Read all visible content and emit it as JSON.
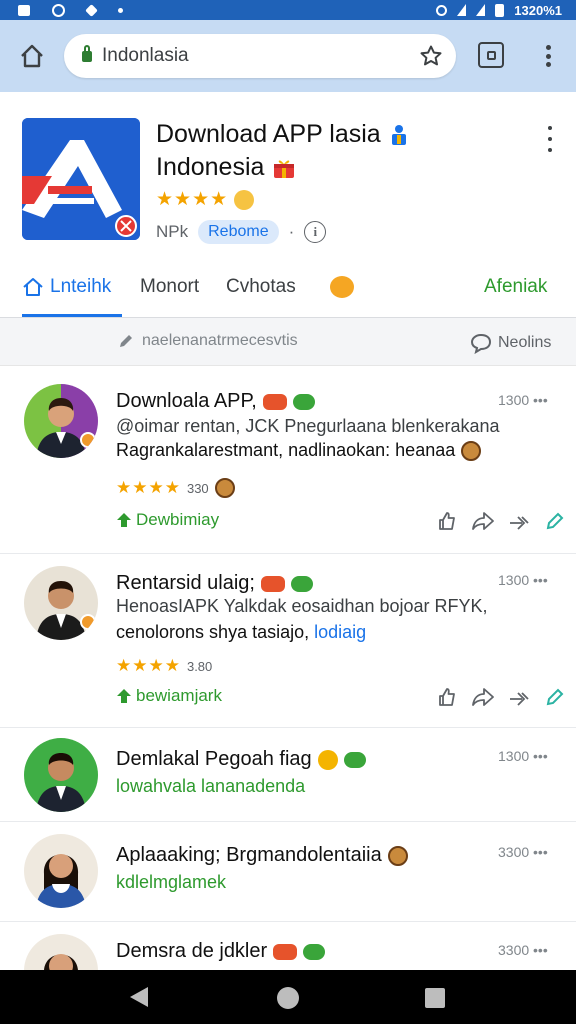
{
  "status_bar": {
    "time": "1320%1"
  },
  "browser": {
    "url": "Indonlasia",
    "home_icon": "home-icon",
    "star_icon": "star-outline-icon",
    "tabs_icon": "tabs-icon",
    "menu_icon": "more-vert-icon"
  },
  "app": {
    "title_line1": "Download APP lasia",
    "title_line2": "Indonesia",
    "stars": "★★★★",
    "meta_prefix": "NPk",
    "chip": "Rebome",
    "info": "i",
    "logo_letter": "A",
    "colors": {
      "brand_blue": "#1f5fcf",
      "accent_red": "#e53935",
      "link_blue": "#1a73e8",
      "green": "#2e9a2e"
    }
  },
  "tabs": [
    {
      "label": "Lnteihk",
      "active": true
    },
    {
      "label": "Monort"
    },
    {
      "label": "Cvhotas"
    },
    {
      "label": ""
    },
    {
      "label": "Afeniak"
    }
  ],
  "filter": {
    "left": "naelenanatrmecesvtis",
    "right": "Neolins"
  },
  "posts": [
    {
      "title": "Downloala APP,",
      "time": "1300 •••",
      "line1": "@oimar rentan, JCK Pnegurlaana blenkerakana",
      "line2": "Ragrankalarestmant, nadlinaokan: heanaa",
      "stars": "★★★★",
      "score": "330",
      "action": "Dewbimiay"
    },
    {
      "title": "Rentarsid ulaig;",
      "time": "1300 •••",
      "line1": "HenoasIAPK Yalkdak eosaidhan bojoar RFYK,",
      "line2": "cenolorons shya tasiajo,",
      "tag": "lodiaig",
      "stars": "★★★★",
      "score": "3.80",
      "action": "bewiamjark"
    },
    {
      "title": "Demlakal Pegoah fiag",
      "time": "1300 •••",
      "line1": "lowahvala lananadenda"
    },
    {
      "title": "Aplaaaking; Brgmandolentaiia",
      "time": "3300 •••",
      "line1": "kdlelmglamek"
    },
    {
      "title": "Demsra de jdkler",
      "time": "3300 •••"
    }
  ]
}
